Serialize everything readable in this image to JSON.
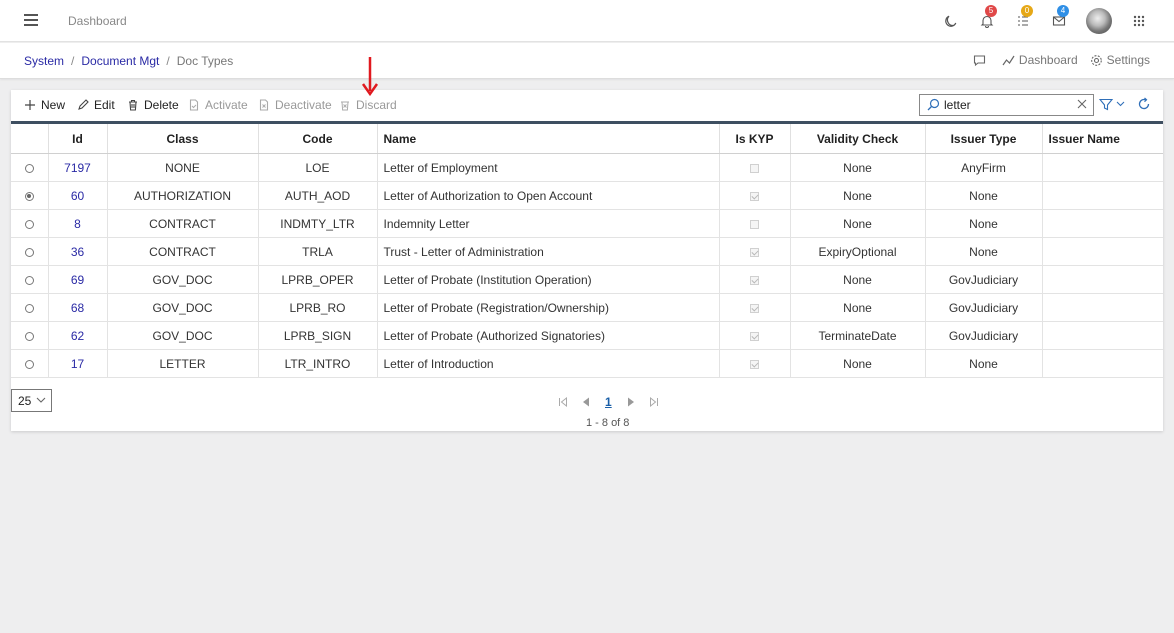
{
  "header": {
    "title": "Dashboard",
    "badges": {
      "notifications": "5",
      "tasks": "0",
      "messages": "4"
    }
  },
  "breadcrumb": {
    "items": [
      "System",
      "Document Mgt"
    ],
    "current": "Doc Types"
  },
  "subnav": {
    "dashboard": "Dashboard",
    "settings": "Settings"
  },
  "toolbar": {
    "new": "New",
    "edit": "Edit",
    "delete": "Delete",
    "activate": "Activate",
    "deactivate": "Deactivate",
    "discard": "Discard"
  },
  "search": {
    "value": "letter"
  },
  "table": {
    "columns": [
      "Id",
      "Class",
      "Code",
      "Name",
      "Is KYP",
      "Validity Check",
      "Issuer Type",
      "Issuer Name"
    ],
    "rows": [
      {
        "id": "7197",
        "class": "NONE",
        "code": "LOE",
        "name": "Letter of Employment",
        "kyp": false,
        "validity": "None",
        "issuer_type": "AnyFirm",
        "issuer_name": "",
        "selected": false
      },
      {
        "id": "60",
        "class": "AUTHORIZATION",
        "code": "AUTH_AOD",
        "name": "Letter of Authorization to Open Account",
        "kyp": true,
        "validity": "None",
        "issuer_type": "None",
        "issuer_name": "",
        "selected": true
      },
      {
        "id": "8",
        "class": "CONTRACT",
        "code": "INDMTY_LTR",
        "name": "Indemnity Letter",
        "kyp": false,
        "validity": "None",
        "issuer_type": "None",
        "issuer_name": "",
        "selected": false
      },
      {
        "id": "36",
        "class": "CONTRACT",
        "code": "TRLA",
        "name": "Trust - Letter of Administration",
        "kyp": true,
        "validity": "ExpiryOptional",
        "issuer_type": "None",
        "issuer_name": "",
        "selected": false
      },
      {
        "id": "69",
        "class": "GOV_DOC",
        "code": "LPRB_OPER",
        "name": "Letter of Probate (Institution Operation)",
        "kyp": true,
        "validity": "None",
        "issuer_type": "GovJudiciary",
        "issuer_name": "",
        "selected": false
      },
      {
        "id": "68",
        "class": "GOV_DOC",
        "code": "LPRB_RO",
        "name": "Letter of Probate (Registration/Ownership)",
        "kyp": true,
        "validity": "None",
        "issuer_type": "GovJudiciary",
        "issuer_name": "",
        "selected": false
      },
      {
        "id": "62",
        "class": "GOV_DOC",
        "code": "LPRB_SIGN",
        "name": "Letter of Probate (Authorized Signatories)",
        "kyp": true,
        "validity": "TerminateDate",
        "issuer_type": "GovJudiciary",
        "issuer_name": "",
        "selected": false
      },
      {
        "id": "17",
        "class": "LETTER",
        "code": "LTR_INTRO",
        "name": "Letter of Introduction",
        "kyp": true,
        "validity": "None",
        "issuer_type": "None",
        "issuer_name": "",
        "selected": false
      }
    ]
  },
  "pagination": {
    "page_size": "25",
    "current_page": "1",
    "info": "1 - 8 of 8"
  },
  "colors": {
    "link": "#2a2aa5",
    "header_border": "#3e4f61",
    "badge_red": "#e04848",
    "badge_yellow": "#e6a817",
    "badge_blue": "#2f8fe6",
    "arrow": "#e0191f"
  }
}
